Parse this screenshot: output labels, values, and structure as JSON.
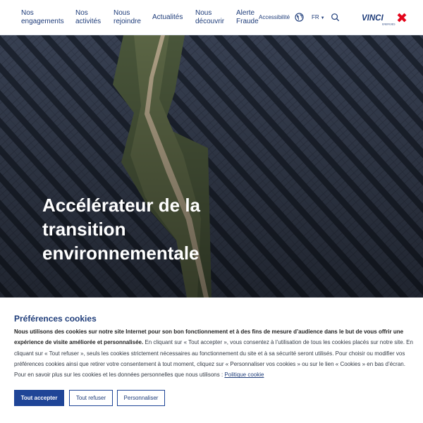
{
  "nav": {
    "items": [
      {
        "line1": "Nos",
        "line2": "engagements"
      },
      {
        "line1": "Nos",
        "line2": "activités"
      },
      {
        "line1": "Nous",
        "line2": "rejoindre"
      },
      {
        "line1": "Actualités",
        "line2": ""
      },
      {
        "line1": "Nous",
        "line2": "découvrir"
      },
      {
        "line1": "Alerte",
        "line2": "Fraude"
      }
    ],
    "accessibility": "Accessibilité",
    "language": "FR",
    "logo_text": "VINCI",
    "logo_sub": "ENERGIES"
  },
  "hero": {
    "title": "Accélérateur de la transition environnementale"
  },
  "cookie": {
    "title": "Préférences cookies",
    "intro_bold": "Nous utilisons des cookies sur notre site Internet pour son bon fonctionnement et à des fins de mesure d’audience dans le but de vous offrir une expérience de visite améliorée et personnalisée.",
    "body": " En cliquant sur « Tout accepter », vous consentez à l’utilisation de tous les cookies placés sur notre site. En cliquant sur « Tout refuser », seuls les cookies strictement nécessaires au fonctionnement du site et à sa sécurité seront utilisés. Pour choisir ou modifier vos préférences cookies ainsi que retirer votre consentement à tout moment, cliquez sur « Personnaliser vos cookies » ou sur le lien « Cookies » en bas d’écran. Pour en savoir plus sur les cookies et les données personnelles que nous utilisons : ",
    "link": "Politique cookie",
    "accept": "Tout accepter",
    "refuse": "Tout refuser",
    "customize": "Personnaliser"
  },
  "colors": {
    "brand_blue": "#1f4597",
    "nav_text": "#1f3d7a",
    "logo_red": "#e3051b"
  }
}
